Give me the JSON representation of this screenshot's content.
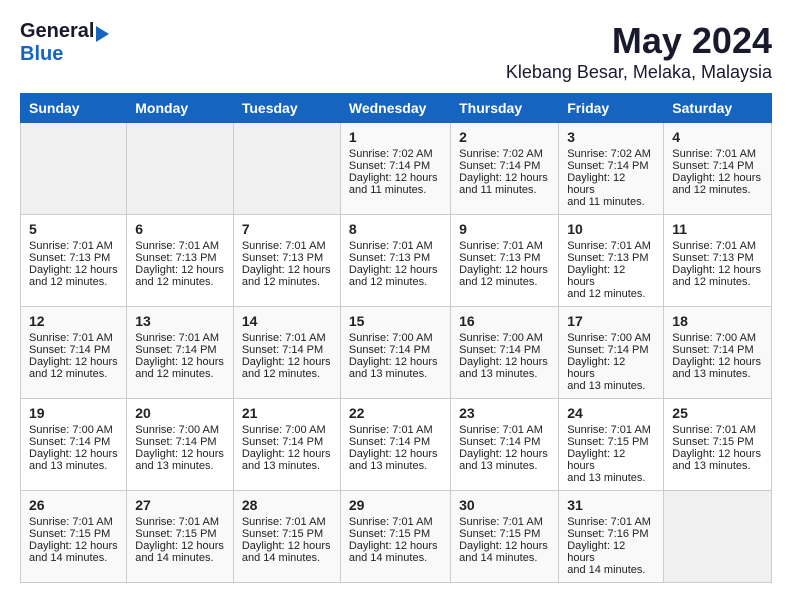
{
  "header": {
    "logo_general": "General",
    "logo_blue": "Blue",
    "title": "May 2024",
    "subtitle": "Klebang Besar, Melaka, Malaysia"
  },
  "calendar": {
    "days_of_week": [
      "Sunday",
      "Monday",
      "Tuesday",
      "Wednesday",
      "Thursday",
      "Friday",
      "Saturday"
    ],
    "weeks": [
      [
        {
          "day": "",
          "info": ""
        },
        {
          "day": "",
          "info": ""
        },
        {
          "day": "",
          "info": ""
        },
        {
          "day": "1",
          "info": "Sunrise: 7:02 AM\nSunset: 7:14 PM\nDaylight: 12 hours\nand 11 minutes."
        },
        {
          "day": "2",
          "info": "Sunrise: 7:02 AM\nSunset: 7:14 PM\nDaylight: 12 hours\nand 11 minutes."
        },
        {
          "day": "3",
          "info": "Sunrise: 7:02 AM\nSunset: 7:14 PM\nDaylight: 12 hours\nand 11 minutes."
        },
        {
          "day": "4",
          "info": "Sunrise: 7:01 AM\nSunset: 7:14 PM\nDaylight: 12 hours\nand 12 minutes."
        }
      ],
      [
        {
          "day": "5",
          "info": "Sunrise: 7:01 AM\nSunset: 7:13 PM\nDaylight: 12 hours\nand 12 minutes."
        },
        {
          "day": "6",
          "info": "Sunrise: 7:01 AM\nSunset: 7:13 PM\nDaylight: 12 hours\nand 12 minutes."
        },
        {
          "day": "7",
          "info": "Sunrise: 7:01 AM\nSunset: 7:13 PM\nDaylight: 12 hours\nand 12 minutes."
        },
        {
          "day": "8",
          "info": "Sunrise: 7:01 AM\nSunset: 7:13 PM\nDaylight: 12 hours\nand 12 minutes."
        },
        {
          "day": "9",
          "info": "Sunrise: 7:01 AM\nSunset: 7:13 PM\nDaylight: 12 hours\nand 12 minutes."
        },
        {
          "day": "10",
          "info": "Sunrise: 7:01 AM\nSunset: 7:13 PM\nDaylight: 12 hours\nand 12 minutes."
        },
        {
          "day": "11",
          "info": "Sunrise: 7:01 AM\nSunset: 7:13 PM\nDaylight: 12 hours\nand 12 minutes."
        }
      ],
      [
        {
          "day": "12",
          "info": "Sunrise: 7:01 AM\nSunset: 7:14 PM\nDaylight: 12 hours\nand 12 minutes."
        },
        {
          "day": "13",
          "info": "Sunrise: 7:01 AM\nSunset: 7:14 PM\nDaylight: 12 hours\nand 12 minutes."
        },
        {
          "day": "14",
          "info": "Sunrise: 7:01 AM\nSunset: 7:14 PM\nDaylight: 12 hours\nand 12 minutes."
        },
        {
          "day": "15",
          "info": "Sunrise: 7:00 AM\nSunset: 7:14 PM\nDaylight: 12 hours\nand 13 minutes."
        },
        {
          "day": "16",
          "info": "Sunrise: 7:00 AM\nSunset: 7:14 PM\nDaylight: 12 hours\nand 13 minutes."
        },
        {
          "day": "17",
          "info": "Sunrise: 7:00 AM\nSunset: 7:14 PM\nDaylight: 12 hours\nand 13 minutes."
        },
        {
          "day": "18",
          "info": "Sunrise: 7:00 AM\nSunset: 7:14 PM\nDaylight: 12 hours\nand 13 minutes."
        }
      ],
      [
        {
          "day": "19",
          "info": "Sunrise: 7:00 AM\nSunset: 7:14 PM\nDaylight: 12 hours\nand 13 minutes."
        },
        {
          "day": "20",
          "info": "Sunrise: 7:00 AM\nSunset: 7:14 PM\nDaylight: 12 hours\nand 13 minutes."
        },
        {
          "day": "21",
          "info": "Sunrise: 7:00 AM\nSunset: 7:14 PM\nDaylight: 12 hours\nand 13 minutes."
        },
        {
          "day": "22",
          "info": "Sunrise: 7:01 AM\nSunset: 7:14 PM\nDaylight: 12 hours\nand 13 minutes."
        },
        {
          "day": "23",
          "info": "Sunrise: 7:01 AM\nSunset: 7:14 PM\nDaylight: 12 hours\nand 13 minutes."
        },
        {
          "day": "24",
          "info": "Sunrise: 7:01 AM\nSunset: 7:15 PM\nDaylight: 12 hours\nand 13 minutes."
        },
        {
          "day": "25",
          "info": "Sunrise: 7:01 AM\nSunset: 7:15 PM\nDaylight: 12 hours\nand 13 minutes."
        }
      ],
      [
        {
          "day": "26",
          "info": "Sunrise: 7:01 AM\nSunset: 7:15 PM\nDaylight: 12 hours\nand 14 minutes."
        },
        {
          "day": "27",
          "info": "Sunrise: 7:01 AM\nSunset: 7:15 PM\nDaylight: 12 hours\nand 14 minutes."
        },
        {
          "day": "28",
          "info": "Sunrise: 7:01 AM\nSunset: 7:15 PM\nDaylight: 12 hours\nand 14 minutes."
        },
        {
          "day": "29",
          "info": "Sunrise: 7:01 AM\nSunset: 7:15 PM\nDaylight: 12 hours\nand 14 minutes."
        },
        {
          "day": "30",
          "info": "Sunrise: 7:01 AM\nSunset: 7:15 PM\nDaylight: 12 hours\nand 14 minutes."
        },
        {
          "day": "31",
          "info": "Sunrise: 7:01 AM\nSunset: 7:16 PM\nDaylight: 12 hours\nand 14 minutes."
        },
        {
          "day": "",
          "info": ""
        }
      ]
    ]
  }
}
